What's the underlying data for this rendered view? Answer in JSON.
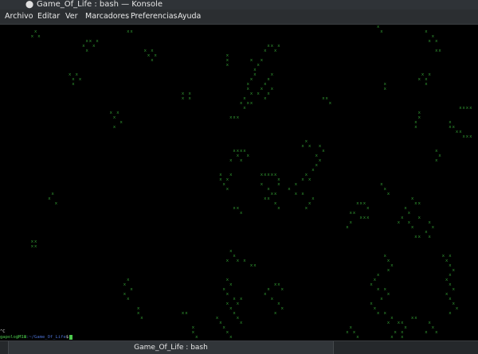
{
  "window": {
    "title": "Game_Of_Life : bash — Konsole",
    "icon": "terminal-app-icon"
  },
  "menu": {
    "items": [
      "Archivo",
      "Editar",
      "Ver",
      "Marcadores",
      "Preferencias",
      "Ayuda"
    ]
  },
  "terminal": {
    "cell_char": "x",
    "interrupt": "^C",
    "prompt_user": "gapolo@M18",
    "prompt_path": ":~/Game_Of_Life",
    "prompt_sign": "$",
    "colors": {
      "cell": "#35a335",
      "user": "#4cc94c",
      "path": "#4a6fd0",
      "background": "#000000"
    }
  },
  "tabs": [
    {
      "label": "Game_Of_Life : bash"
    }
  ]
}
